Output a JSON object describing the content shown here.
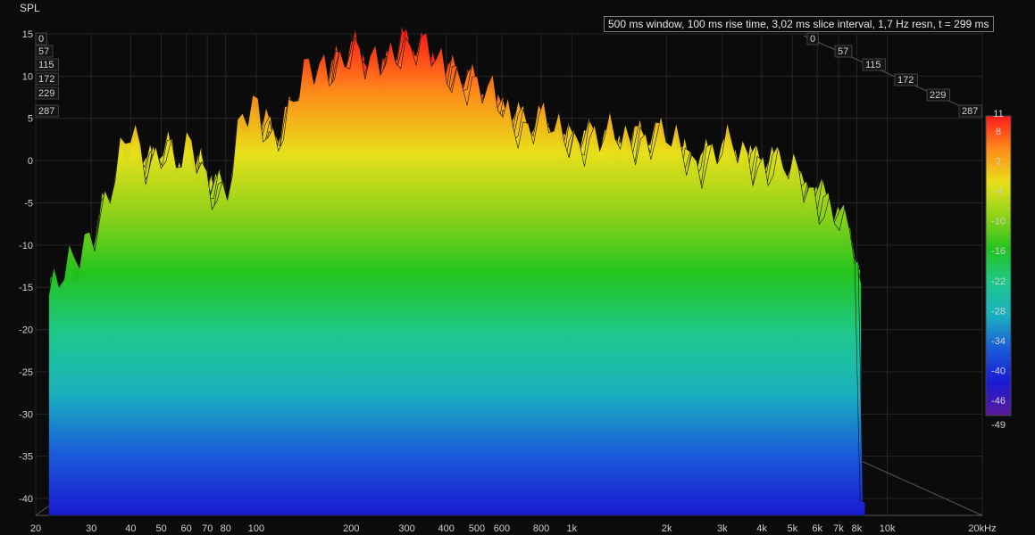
{
  "chart_data": {
    "type": "waterfall",
    "title": "500 ms window, 100 ms rise time, 3,02 ms slice interval, 1,7 Hz resn, t = 299 ms",
    "ylabel": "SPL",
    "yticks": [
      15,
      10,
      5,
      0,
      -5,
      -10,
      -15,
      -20,
      -25,
      -30,
      -35,
      -40
    ],
    "ylim": [
      -42,
      15
    ],
    "xticks": [
      "20",
      "30",
      "40",
      "50",
      "60",
      "70",
      "80",
      "100",
      "200",
      "300",
      "400",
      "500",
      "600",
      "800",
      "1k",
      "2k",
      "3k",
      "4k",
      "5k",
      "6k",
      "7k",
      "8k",
      "10k",
      "20kHz"
    ],
    "xtick_values": [
      20,
      30,
      40,
      50,
      60,
      70,
      80,
      100,
      200,
      300,
      400,
      500,
      600,
      800,
      1000,
      2000,
      3000,
      4000,
      5000,
      6000,
      7000,
      8000,
      10000,
      20000
    ],
    "xlim": [
      20,
      20000
    ],
    "time_ticks": [
      "0",
      "57",
      "115",
      "172",
      "229",
      "287"
    ],
    "time_unit": "ms",
    "colorbar_ticks": [
      "11",
      "8",
      "2",
      "-4",
      "-10",
      "-16",
      "-22",
      "-28",
      "-34",
      "-40",
      "-46",
      "-49"
    ],
    "colorbar_range": [
      -49,
      11
    ],
    "colorbar_colors": [
      "#ff1a1a",
      "#ff8c1a",
      "#e8e01a",
      "#8fd21a",
      "#22c41e",
      "#1ec88c",
      "#1ab0c0",
      "#1a5ad8",
      "#1a1ad2",
      "#5a1a9a"
    ],
    "envelope": {
      "freqs_hz": [
        22,
        25,
        28,
        32,
        36,
        40,
        45,
        50,
        56,
        63,
        70,
        80,
        90,
        100,
        112,
        125,
        140,
        160,
        180,
        200,
        225,
        250,
        280,
        315,
        355,
        400,
        450,
        500,
        560,
        630,
        710,
        800,
        900,
        1000,
        1250,
        1600,
        2000,
        2500,
        3150,
        4000,
        5000,
        6000,
        7000,
        8000
      ],
      "peak_db": [
        -16,
        -14,
        -10,
        -6,
        -2,
        3,
        0,
        2,
        -1,
        1,
        -2,
        -4,
        4,
        6,
        3,
        5,
        9,
        11,
        12,
        13,
        10,
        12,
        14,
        13,
        12,
        11,
        10,
        8,
        7,
        6,
        4,
        4,
        3,
        3,
        2,
        3,
        2,
        0,
        1,
        0,
        -2,
        -4,
        -7,
        -12
      ]
    }
  }
}
